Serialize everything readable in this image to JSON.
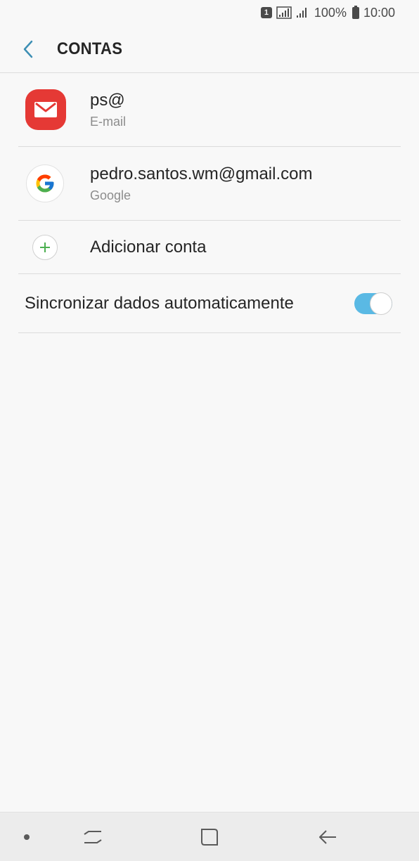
{
  "status_bar": {
    "sim_number": "1",
    "battery_percent": "100%",
    "time": "10:00"
  },
  "header": {
    "title": "CONTAS",
    "back_icon": "chevron-left-icon"
  },
  "accounts": [
    {
      "name": "ps@",
      "type": "E-mail",
      "icon": "email-app-icon"
    },
    {
      "name": "pedro.santos.wm@gmail.com",
      "type": "Google",
      "icon": "google-icon"
    }
  ],
  "add_account": {
    "label": "Adicionar conta",
    "icon": "plus-icon"
  },
  "auto_sync": {
    "label": "Sincronizar dados automaticamente",
    "enabled": true
  },
  "colors": {
    "accent": "#5ab9e4",
    "email_icon": "#e53935",
    "add_plus": "#4caf50",
    "back_chevron": "#3d8fb4"
  },
  "nav_bar": {
    "icons": [
      "dot-icon",
      "recents-icon",
      "home-icon",
      "back-arrow-icon"
    ]
  }
}
